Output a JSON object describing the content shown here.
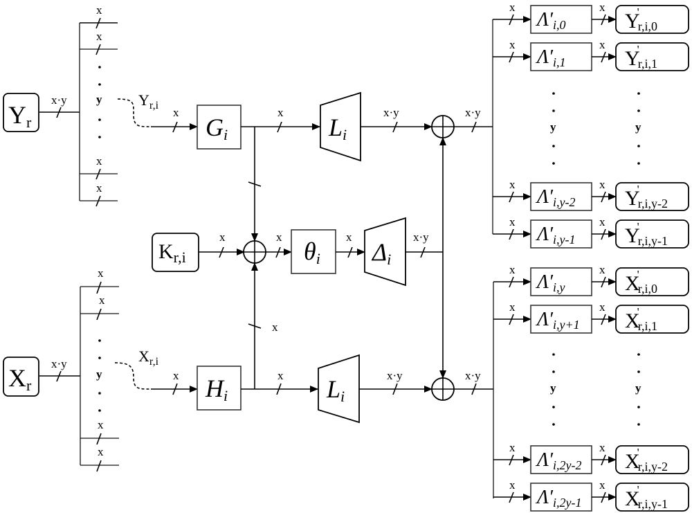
{
  "diagram": {
    "inputs": {
      "Y": {
        "main": "Y",
        "sub": "r"
      },
      "X": {
        "main": "X",
        "sub": "r"
      },
      "K": {
        "main": "K",
        "sub": "r,i"
      }
    },
    "bus_labels": {
      "xy": "x·y",
      "x": "x",
      "y": "y"
    },
    "signals": {
      "Yri": {
        "main": "Y",
        "sub": "r,i"
      },
      "Xri": {
        "main": "X",
        "sub": "r,i"
      }
    },
    "blocks": {
      "G": {
        "main": "G",
        "sub": "i"
      },
      "H": {
        "main": "H",
        "sub": "i"
      },
      "L_top": {
        "main": "L",
        "sub": "i"
      },
      "L_bottom": {
        "main": "L",
        "sub": "i"
      },
      "theta": {
        "main": "θ",
        "sub": "i"
      },
      "Delta": {
        "main": "Δ",
        "sub": "i"
      }
    },
    "lambda_blocks": [
      {
        "main": "Λ′",
        "sub": "i,0"
      },
      {
        "main": "Λ′",
        "sub": "i,1"
      },
      {
        "main": "Λ′",
        "sub": "i,y-2"
      },
      {
        "main": "Λ′",
        "sub": "i,y-1"
      },
      {
        "main": "Λ′",
        "sub": "i,y"
      },
      {
        "main": "Λ′",
        "sub": "i,y+1"
      },
      {
        "main": "Λ′",
        "sub": "i,2y-2"
      },
      {
        "main": "Λ′",
        "sub": "i,2y-1"
      }
    ],
    "outputs": [
      {
        "main": "Y",
        "prime": "'",
        "sub": "r,i,0"
      },
      {
        "main": "Y",
        "prime": "'",
        "sub": "r,i,1"
      },
      {
        "main": "Y",
        "prime": "'",
        "sub": "r,i,y-2"
      },
      {
        "main": "Y",
        "prime": "'",
        "sub": "r,i,y-1"
      },
      {
        "main": "X",
        "prime": "'",
        "sub": "r,i,0"
      },
      {
        "main": "X",
        "prime": "'",
        "sub": "r,i,1"
      },
      {
        "main": "X",
        "prime": "'",
        "sub": "r,i,y-2"
      },
      {
        "main": "X",
        "prime": "'",
        "sub": "r,i,y-1"
      }
    ]
  }
}
